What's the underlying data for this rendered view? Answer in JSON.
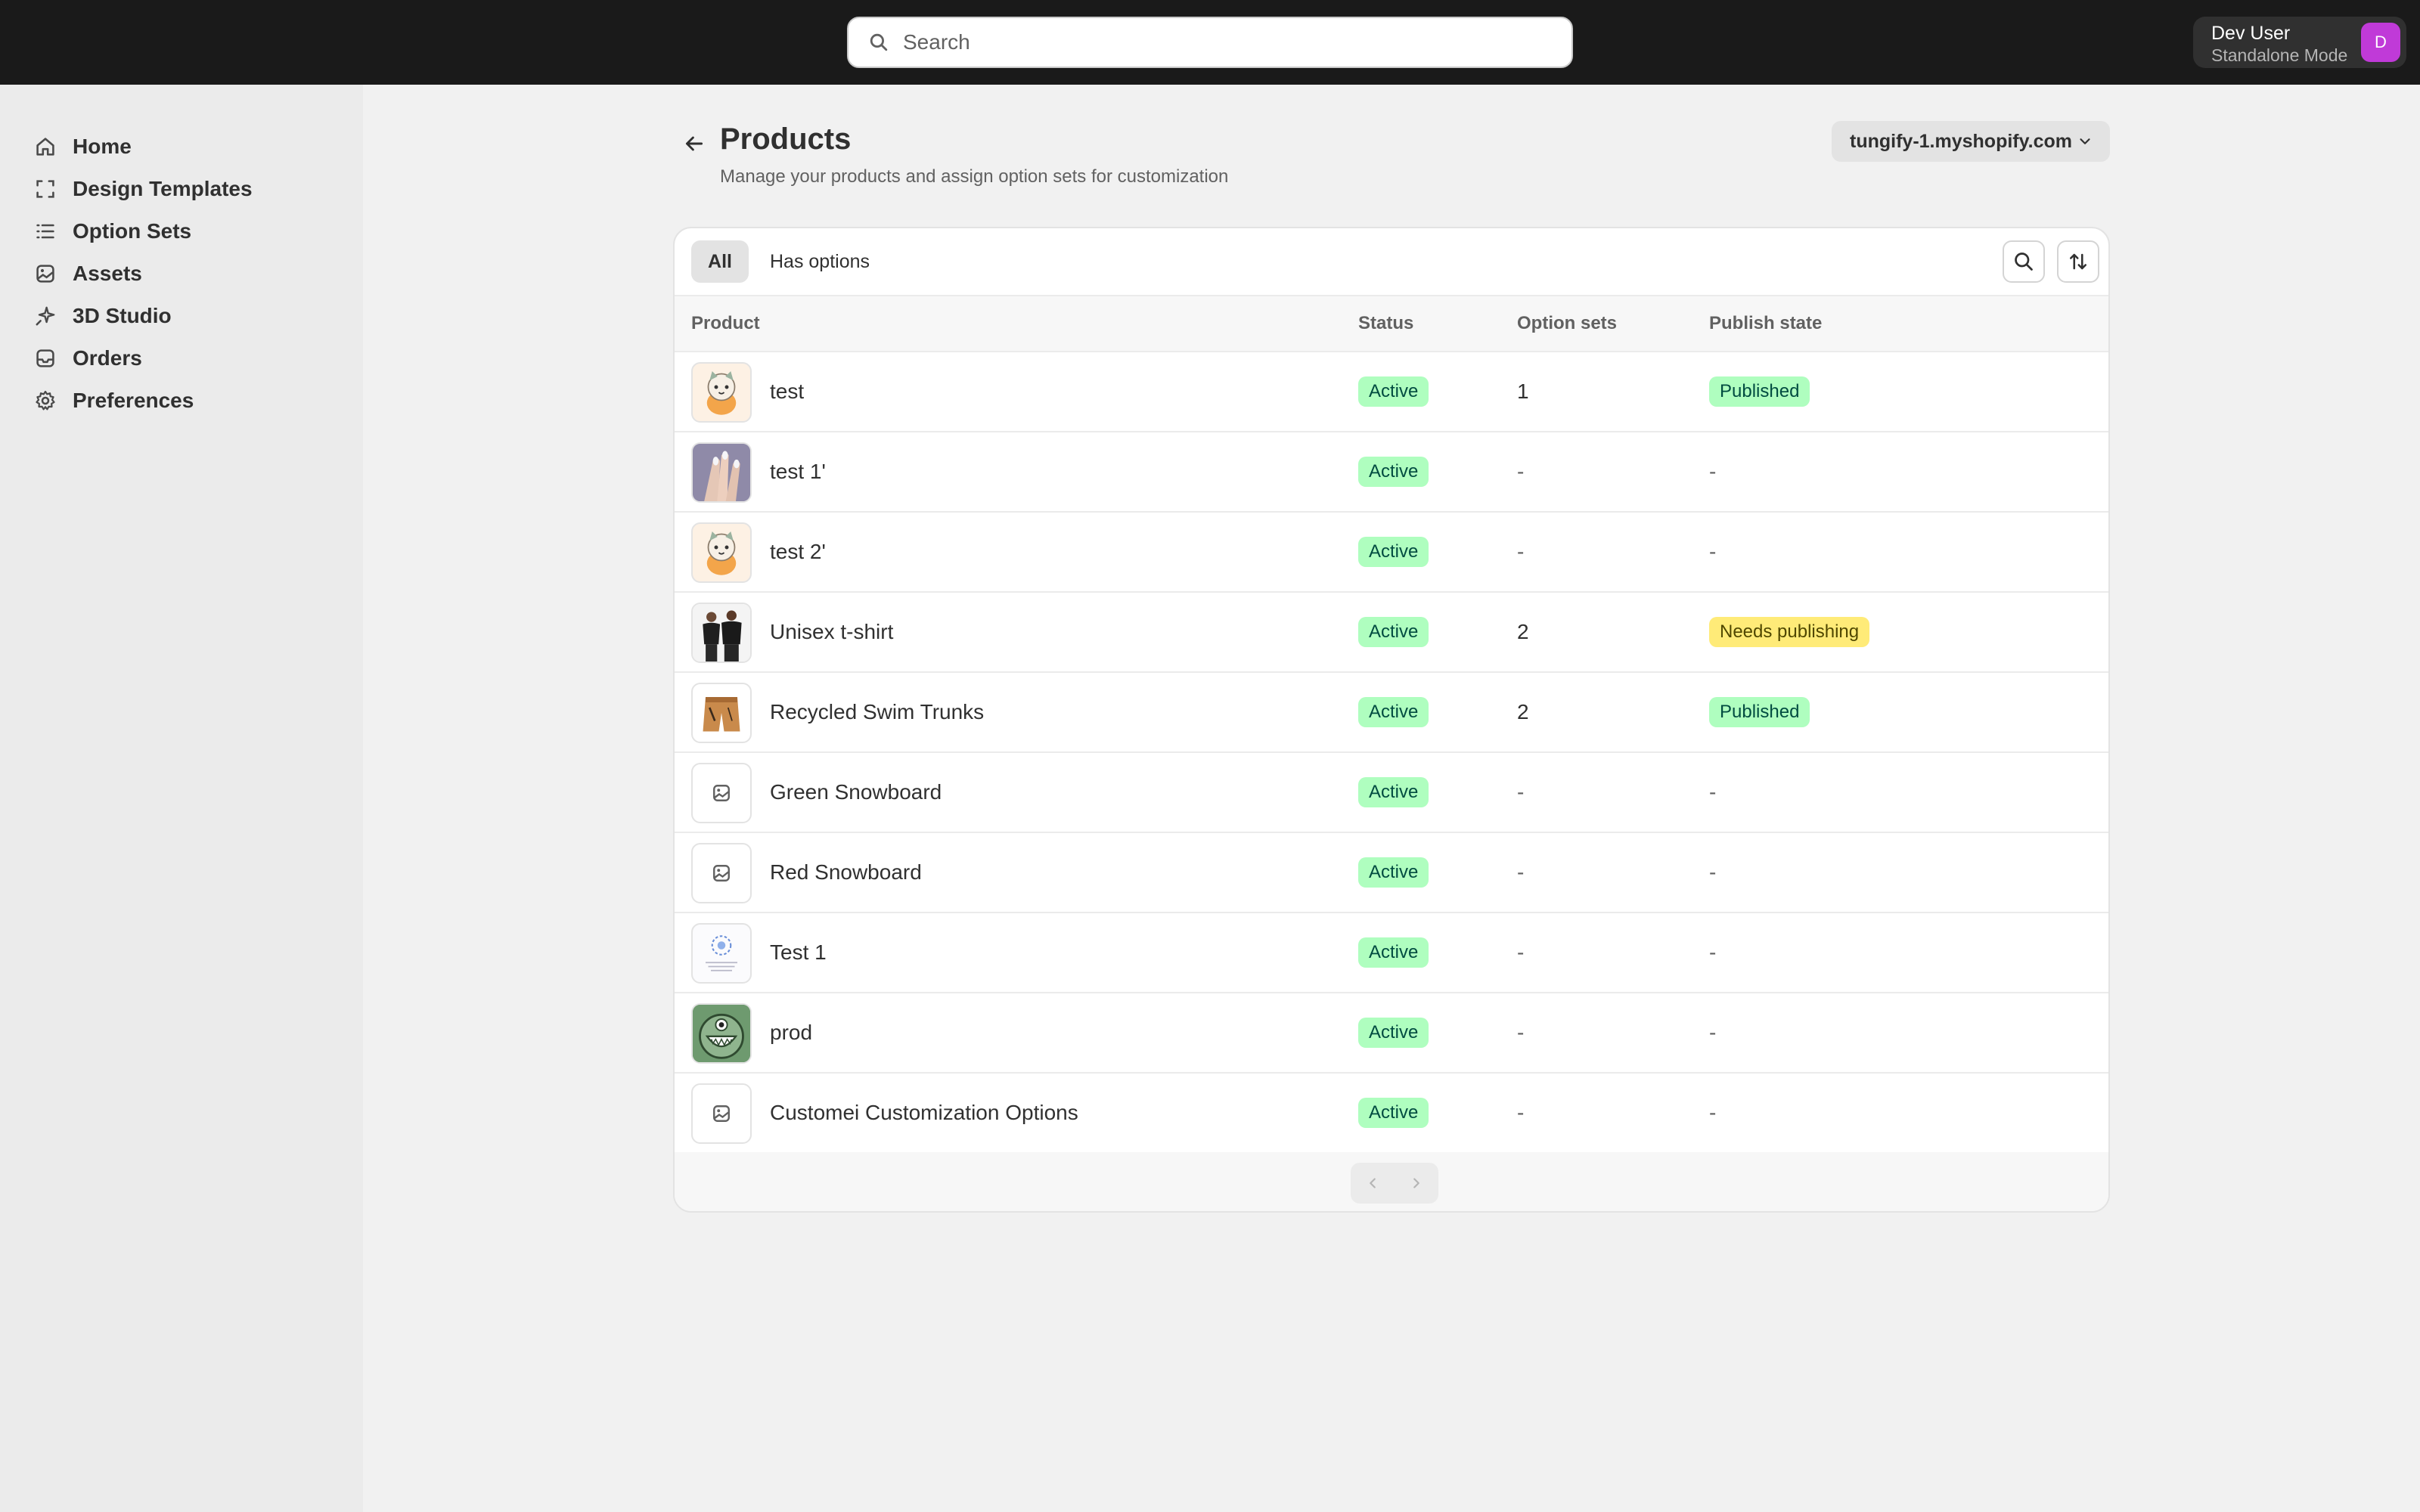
{
  "search": {
    "placeholder": "Search"
  },
  "user": {
    "name": "Dev User",
    "mode": "Standalone Mode",
    "avatar_letter": "D",
    "avatar_color": "#c03ad8"
  },
  "sidebar": {
    "items": [
      {
        "label": "Home",
        "icon": "home-icon"
      },
      {
        "label": "Design Templates",
        "icon": "frame-icon"
      },
      {
        "label": "Option Sets",
        "icon": "list-icon"
      },
      {
        "label": "Assets",
        "icon": "image-icon"
      },
      {
        "label": "3D Studio",
        "icon": "sparkle-icon"
      },
      {
        "label": "Orders",
        "icon": "inbox-icon"
      },
      {
        "label": "Preferences",
        "icon": "gear-icon"
      }
    ]
  },
  "header": {
    "title": "Products",
    "subtitle": "Manage your products and assign option sets for customization",
    "store": "tungify-1.myshopify.com"
  },
  "tabs": [
    {
      "label": "All",
      "active": true
    },
    {
      "label": "Has options",
      "active": false
    }
  ],
  "table": {
    "columns": [
      "Product",
      "Status",
      "Option sets",
      "Publish state"
    ],
    "rows": [
      {
        "name": "test",
        "status": "Active",
        "option_sets": "1",
        "publish": "Published",
        "thumb": "cat-icon"
      },
      {
        "name": "test 1'",
        "status": "Active",
        "option_sets": "-",
        "publish": "-",
        "thumb": "nails-photo"
      },
      {
        "name": "test 2'",
        "status": "Active",
        "option_sets": "-",
        "publish": "-",
        "thumb": "cat-icon"
      },
      {
        "name": "Unisex t-shirt",
        "status": "Active",
        "option_sets": "2",
        "publish": "Needs publishing",
        "thumb": "tshirt-photo"
      },
      {
        "name": "Recycled Swim Trunks",
        "status": "Active",
        "option_sets": "2",
        "publish": "Published",
        "thumb": "trunks-photo"
      },
      {
        "name": "Green Snowboard",
        "status": "Active",
        "option_sets": "-",
        "publish": "-",
        "thumb": "placeholder-image-icon"
      },
      {
        "name": "Red Snowboard",
        "status": "Active",
        "option_sets": "-",
        "publish": "-",
        "thumb": "placeholder-image-icon"
      },
      {
        "name": "Test 1",
        "status": "Active",
        "option_sets": "-",
        "publish": "-",
        "thumb": "document-thumb"
      },
      {
        "name": "prod",
        "status": "Active",
        "option_sets": "-",
        "publish": "-",
        "thumb": "monster-icon"
      },
      {
        "name": "Customei Customization Options",
        "status": "Active",
        "option_sets": "-",
        "publish": "-",
        "thumb": "placeholder-image-icon"
      }
    ]
  },
  "colors": {
    "topbar": "#1a1a1a",
    "active_badge": "#affebf",
    "needs_publishing_badge": "#ffeb78"
  }
}
